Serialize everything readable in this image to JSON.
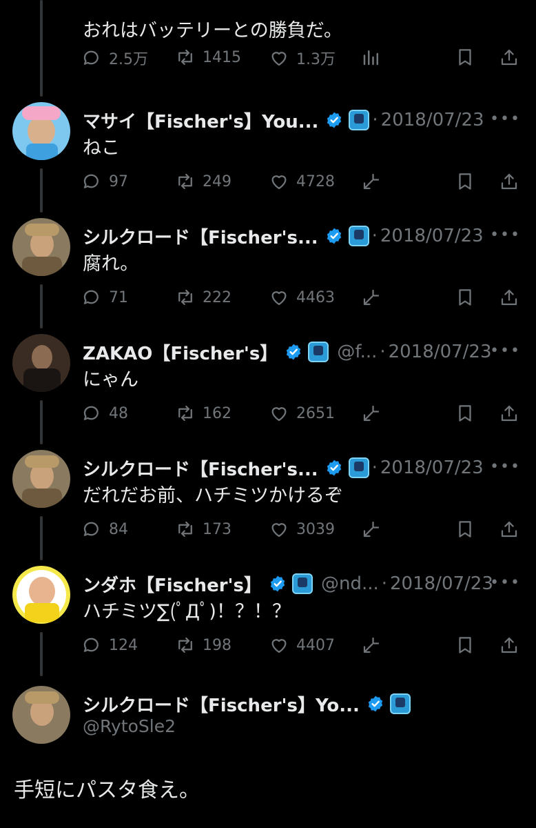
{
  "first_tweet": {
    "text": "おれはバッテリーとの勝負だ。",
    "replies": "2.5万",
    "retweets": "1415",
    "likes": "1.3万"
  },
  "replies": [
    {
      "name": "マサイ【Fischer's】You...",
      "handle": "",
      "date": "2018/07/23",
      "text": "ねこ",
      "replies": "97",
      "retweets": "249",
      "likes": "4728",
      "avatar": "masai"
    },
    {
      "name": "シルクロード【Fischer's...",
      "handle": "",
      "date": "2018/07/23",
      "text": "腐れ。",
      "replies": "71",
      "retweets": "222",
      "likes": "4463",
      "avatar": "silk"
    },
    {
      "name": "ZAKAO【Fischer's】",
      "handle": "@f...",
      "date": "2018/07/23",
      "text": "にゃん",
      "replies": "48",
      "retweets": "162",
      "likes": "2651",
      "avatar": "zakao"
    },
    {
      "name": "シルクロード【Fischer's...",
      "handle": "",
      "date": "2018/07/23",
      "text": "だれだお前、ハチミツかけるぞ",
      "replies": "84",
      "retweets": "173",
      "likes": "3039",
      "avatar": "silk"
    },
    {
      "name": "ンダホ【Fischer's】",
      "handle": "@nd...",
      "date": "2018/07/23",
      "text": "ハチミツ∑(ﾟДﾟ)！？！？",
      "replies": "124",
      "retweets": "198",
      "likes": "4407",
      "avatar": "ndaho"
    }
  ],
  "main_tweet": {
    "name": "シルクロード【Fischer's】Yo...",
    "handle": "@RytoSle2",
    "text": "手短にパスタ食え。"
  },
  "icons": {
    "reply": "reply-icon",
    "retweet": "retweet-icon",
    "like": "heart-icon",
    "views": "views-icon",
    "grok": "grok-icon",
    "bookmark": "bookmark-icon",
    "share": "share-icon",
    "more": "more-icon",
    "verified": "verified-badge-icon",
    "affiliate": "affiliate-badge-icon"
  },
  "colors": {
    "background": "#000000",
    "text": "#e7e9ea",
    "muted": "#71767b",
    "verified": "#1d9bf0",
    "thread_line": "#333639"
  }
}
